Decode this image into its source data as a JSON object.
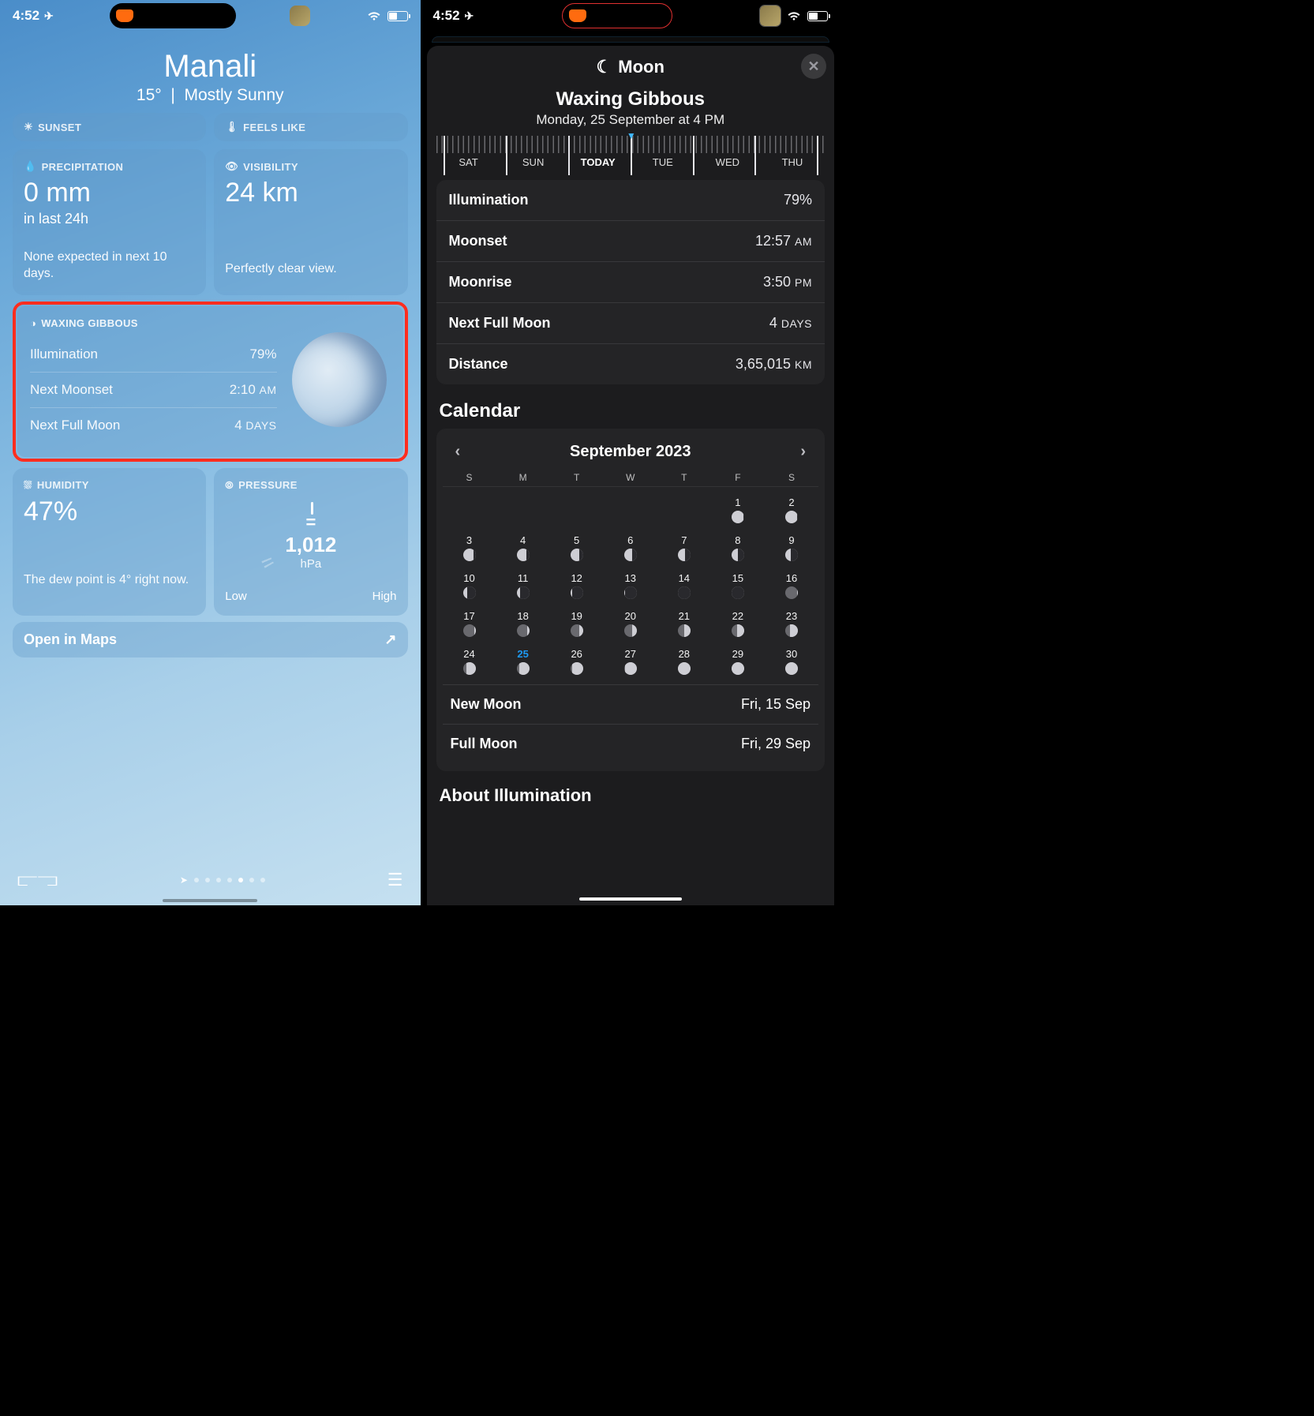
{
  "status": {
    "time": "4:52",
    "location_arrow": "➤"
  },
  "left": {
    "city": "Manali",
    "temp": "15°",
    "separator": "|",
    "condition": "Mostly Sunny",
    "strip1": {
      "sunset": "SUNSET",
      "feels": "FEELS LIKE"
    },
    "precip": {
      "label": "PRECIPITATION",
      "value": "0 mm",
      "sub": "in last 24h",
      "note": "None expected in next 10 days."
    },
    "visibility": {
      "label": "VISIBILITY",
      "value": "24 km",
      "note": "Perfectly clear view."
    },
    "moon": {
      "label": "WAXING GIBBOUS",
      "rows": [
        {
          "k": "Illumination",
          "v": "79%"
        },
        {
          "k": "Next Moonset",
          "v": "2:10",
          "suffix": "AM"
        },
        {
          "k": "Next Full Moon",
          "v": "4",
          "suffix": "DAYS"
        }
      ]
    },
    "humidity": {
      "label": "HUMIDITY",
      "value": "47%",
      "note": "The dew point is 4° right now."
    },
    "pressure": {
      "label": "PRESSURE",
      "eq": "=",
      "value": "1,012",
      "unit": "hPa",
      "low": "Low",
      "high": "High"
    },
    "open_maps": "Open in Maps"
  },
  "right": {
    "sheet_title": "Moon",
    "phase_name": "Waxing Gibbous",
    "phase_date": "Monday, 25 September at 4 PM",
    "ruler_days": [
      "SAT",
      "SUN",
      "TODAY",
      "TUE",
      "WED",
      "THU"
    ],
    "details": [
      {
        "k": "Illumination",
        "v": "79%"
      },
      {
        "k": "Moonset",
        "v": "12:57",
        "suffix": "AM"
      },
      {
        "k": "Moonrise",
        "v": "3:50",
        "suffix": "PM"
      },
      {
        "k": "Next Full Moon",
        "v": "4",
        "suffix": "DAYS"
      },
      {
        "k": "Distance",
        "v": "3,65,015",
        "suffix": "KM"
      }
    ],
    "calendar_title": "Calendar",
    "cal_month": "September 2023",
    "dow": [
      "S",
      "M",
      "T",
      "W",
      "T",
      "F",
      "S"
    ],
    "days": [
      null,
      null,
      null,
      null,
      null,
      {
        "n": 1,
        "p": 0.96
      },
      {
        "n": 2,
        "p": 0.92
      },
      {
        "n": 3,
        "p": 0.86
      },
      {
        "n": 4,
        "p": 0.8
      },
      {
        "n": 5,
        "p": 0.73
      },
      {
        "n": 6,
        "p": 0.66
      },
      {
        "n": 7,
        "p": 0.58
      },
      {
        "n": 8,
        "p": 0.5
      },
      {
        "n": 9,
        "p": 0.42
      },
      {
        "n": 10,
        "p": 0.33
      },
      {
        "n": 11,
        "p": 0.25
      },
      {
        "n": 12,
        "p": 0.17
      },
      {
        "n": 13,
        "p": 0.09
      },
      {
        "n": 14,
        "p": 0.03
      },
      {
        "n": 15,
        "p": 0.0
      },
      {
        "n": 16,
        "p": 0.04
      },
      {
        "n": 17,
        "p": 0.1
      },
      {
        "n": 18,
        "p": 0.18
      },
      {
        "n": 19,
        "p": 0.27
      },
      {
        "n": 20,
        "p": 0.36
      },
      {
        "n": 21,
        "p": 0.46
      },
      {
        "n": 22,
        "p": 0.55
      },
      {
        "n": 23,
        "p": 0.64
      },
      {
        "n": 24,
        "p": 0.72
      },
      {
        "n": 25,
        "p": 0.79,
        "today": true
      },
      {
        "n": 26,
        "p": 0.86
      },
      {
        "n": 27,
        "p": 0.92
      },
      {
        "n": 28,
        "p": 0.96
      },
      {
        "n": 29,
        "p": 1.0
      },
      {
        "n": 30,
        "p": 0.98
      }
    ],
    "events": [
      {
        "k": "New Moon",
        "v": "Fri, 15 Sep"
      },
      {
        "k": "Full Moon",
        "v": "Fri, 29 Sep"
      }
    ],
    "about": "About Illumination"
  }
}
